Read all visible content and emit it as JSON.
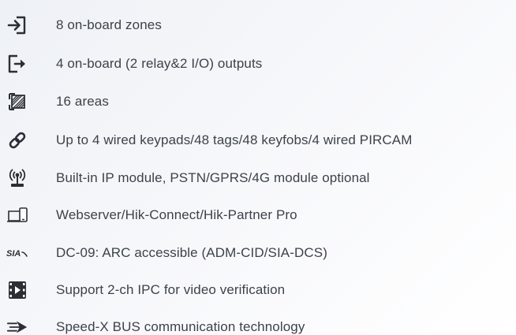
{
  "features": [
    {
      "icon": "input-zone-icon",
      "text": "8 on-board zones"
    },
    {
      "icon": "output-icon",
      "text": "4 on-board (2 relay&2 I/O) outputs"
    },
    {
      "icon": "area-icon",
      "text": "16 areas"
    },
    {
      "icon": "link-icon",
      "text": "Up to 4 wired keypads/48 tags/48 keyfobs/4 wired PIRCAM"
    },
    {
      "icon": "wireless-module-icon",
      "text": "Built-in IP module, PSTN/GPRS/4G module optional"
    },
    {
      "icon": "devices-icon",
      "text": "Webserver/Hik-Connect/Hik-Partner Pro"
    },
    {
      "icon": "sia-logo-icon",
      "text": "DC-09: ARC accessible (ADM-CID/SIA-DCS)"
    },
    {
      "icon": "video-play-icon",
      "text": "Support 2-ch IPC for video verification"
    },
    {
      "icon": "speed-arrow-icon",
      "text": "Speed-X BUS communication technology"
    }
  ],
  "colors": {
    "icon": "#2b2f35",
    "text": "#3d424a"
  }
}
